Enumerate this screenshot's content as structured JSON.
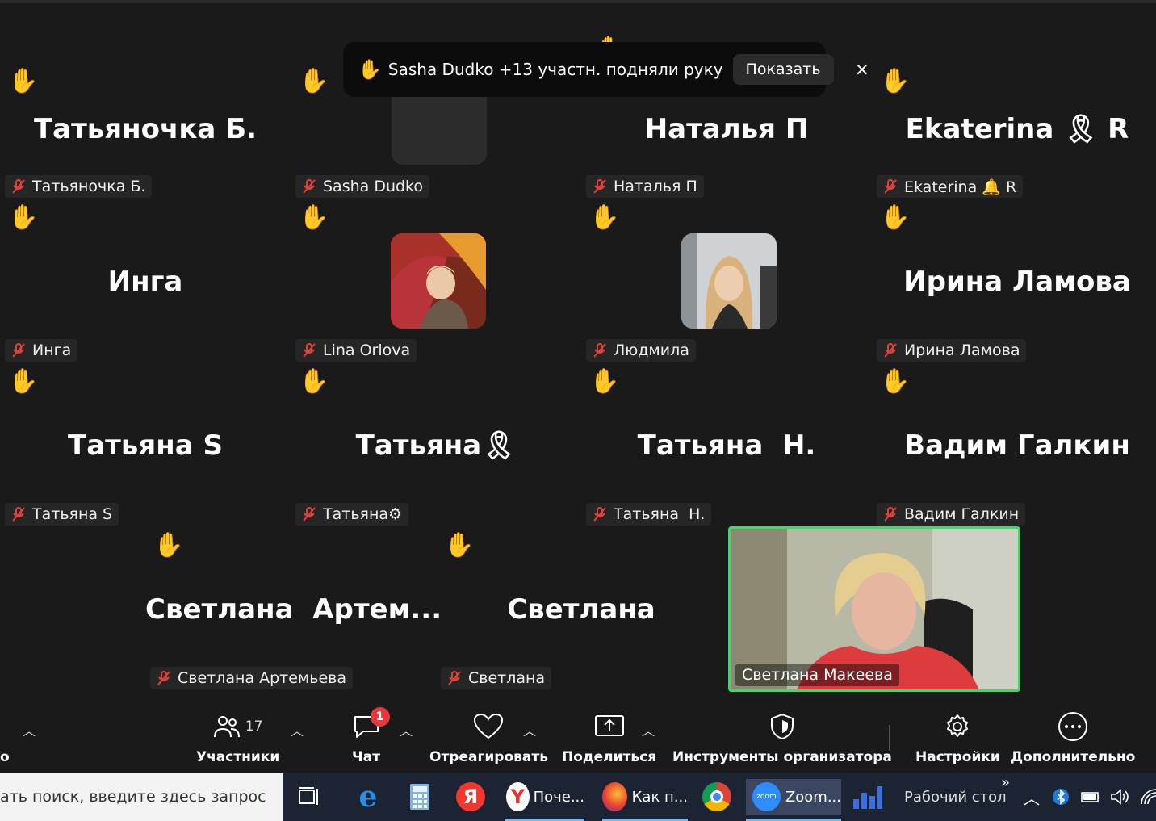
{
  "notification": {
    "text": "Sasha Dudko +13 участн. подняли руку",
    "show_button": "Показать",
    "close": "×"
  },
  "tiles": [
    {
      "big": "Татьяночка Б.",
      "tag": "Татьяночка Б.",
      "hand": true
    },
    {
      "big": "",
      "tag": "Sasha Dudko",
      "hand": true
    },
    {
      "big": "Наталья П",
      "tag": "Наталья П",
      "hand": true
    },
    {
      "big": "Ekaterina 🎗 R",
      "tag": "Ekaterina 🔔 R",
      "hand": true
    },
    {
      "big": "Инга",
      "tag": "Инга",
      "hand": true
    },
    {
      "big": "",
      "tag": "Lina Orlova",
      "hand": true
    },
    {
      "big": "",
      "tag": "Людмила",
      "hand": true
    },
    {
      "big": "Ирина Ламова",
      "tag": "Ирина Ламова",
      "hand": true
    },
    {
      "big": "Татьяна S",
      "tag": "Татьяна S",
      "hand": true
    },
    {
      "big": "Татьяна🎗",
      "tag": "Татьяна⚙",
      "hand": true
    },
    {
      "big": "Татьяна  Н.",
      "tag": "Татьяна  Н.",
      "hand": true
    },
    {
      "big": "Вадим Галкин",
      "tag": "Вадим Галкин",
      "hand": true
    },
    {
      "big": "Светлана  Артем...",
      "tag": "Светлана Артемьева",
      "hand": true
    },
    {
      "big": "Светлана",
      "tag": "Светлана",
      "hand": true
    }
  ],
  "speaker": {
    "tag": "Светлана Макеева"
  },
  "toolbar": {
    "participants_count": "17",
    "participants": "Участники",
    "chat": "Чат",
    "chat_badge": "1",
    "react": "Отреагировать",
    "share": "Поделиться",
    "host_tools": "Инструменты организатора",
    "settings": "Настройки",
    "more": "Дополнительно",
    "left_cut": "о"
  },
  "taskbar": {
    "search_placeholder": "ать поиск, введите здесь запрос",
    "yandex_browser": "Поче...",
    "firefox": "Как п...",
    "zoom": "Zoom...",
    "desktop": "Рабочий стол",
    "more": "»"
  },
  "colors": {
    "speaker_border": "#3fd96b",
    "badge": "#e8373c",
    "taskbar": "#1c2434"
  }
}
